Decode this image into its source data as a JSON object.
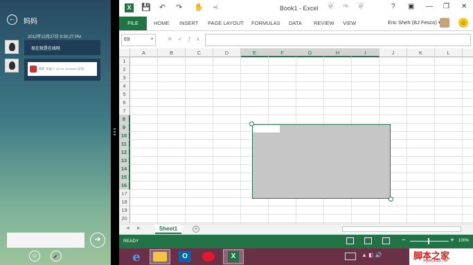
{
  "chat": {
    "back_icon": "←",
    "title": "妈妈",
    "timestamp": "2012年12月27日 9:30:27 PM",
    "messages": [
      {
        "text": "现在就是在线呀"
      },
      {
        "card_text": "重要: 本窗口 \"QQ for Windows (试用)\""
      }
    ],
    "input_value": "",
    "send_icon": "➜",
    "emoji_icon": "☺",
    "mic_icon": "🎤"
  },
  "excel": {
    "app_icon": "X",
    "quick_access": {
      "save": "💾",
      "undo": "↶",
      "redo": "↷",
      "touch": "✋",
      "customize": "⩤"
    },
    "window_title": "Book1 - Excel",
    "decor": "❦ ❧ ❦",
    "window_buttons": {
      "help": "?",
      "ribbon_display": "▣",
      "minimize": "—",
      "restore": "❐",
      "close": "✕"
    },
    "ribbon_tabs": [
      "FILE",
      "HOME",
      "INSERT",
      "PAGE LAYOUT",
      "FORMULAS",
      "DATA",
      "REVIEW",
      "VIEW"
    ],
    "user_name": "Eric Sheh (BJ Fesco)",
    "user_dropdown": "▾",
    "smiley": "☺",
    "name_box": "E8",
    "formula_icons": "✕✓ƒx",
    "formula_value": "",
    "columns": [
      "A",
      "B",
      "C",
      "D",
      "E",
      "F",
      "G",
      "H",
      "I",
      "J",
      "K",
      "L"
    ],
    "selected_columns": [
      "E",
      "F",
      "G",
      "H",
      "I"
    ],
    "rows": [
      "1",
      "2",
      "3",
      "4",
      "5",
      "6",
      "7",
      "8",
      "9",
      "10",
      "11",
      "12",
      "13",
      "14",
      "15",
      "16",
      "17",
      "18",
      "19",
      "20"
    ],
    "selected_rows": [
      "8",
      "9",
      "10",
      "11",
      "12",
      "13",
      "14",
      "15",
      "16"
    ],
    "sheet_nav_prev": "◀",
    "sheet_nav_next": "▶",
    "sheet_tab": "Sheet1",
    "add_sheet": "+",
    "status": "READY",
    "zoom_minus": "−",
    "zoom_plus": "+",
    "zoom": "100%"
  },
  "taskbar": {
    "apps": [
      {
        "id": "ie",
        "glyph": "e"
      },
      {
        "id": "folder",
        "glyph": ""
      },
      {
        "id": "outlook",
        "glyph": "O"
      },
      {
        "id": "weibo",
        "glyph": ""
      },
      {
        "id": "excel",
        "glyph": "X"
      }
    ],
    "tray": "▲ ◧ 🔊",
    "watermark": "脚本之家",
    "watermark_sub": "www.jb51.net"
  }
}
